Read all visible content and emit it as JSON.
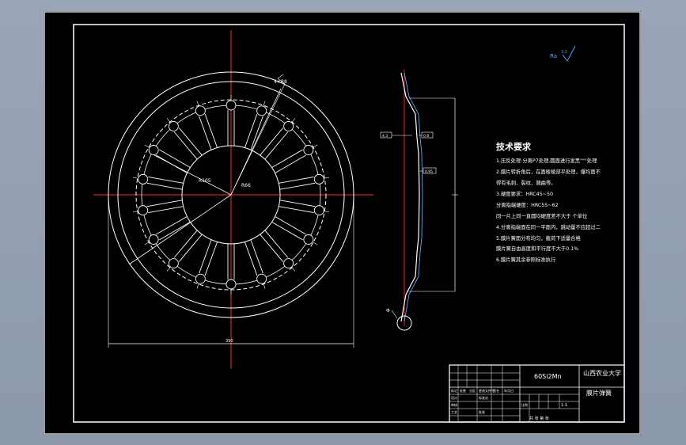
{
  "roughness": {
    "symbol": "Ra",
    "value": "3.2"
  },
  "tech_requirements": {
    "title": "技术要求",
    "lines": [
      "1.压反处理:分离P7处理,圆面进行发黑\"\"\"处理",
      "2.膜片转折角后，在面棱棱部平处理，爆均面不",
      "得有毛刺、裂纹、翘曲等。",
      "3.硬度要求：HRC45~50",
      "分离指端硬度：HRC55~62",
      "同一片上同一直圆均硬度差不大于 个单位",
      "4.分离指端面在同一平面内，跳动量不应超过二",
      "5.膜片簧面分布均匀，载荷下适量合格",
      "膜片簧自由高度和平行度不大于0.1%",
      "6.膜片簧其余参照标准执行"
    ]
  },
  "title_block": {
    "material": "60Si2Mn",
    "school": "山西农业大学",
    "part_name": "膜片弹簧",
    "scale_label": "比例",
    "scale": "1:1",
    "sheet_label": "共 张 第 张",
    "small_labels": [
      "标记",
      "处数",
      "分区",
      "更改文件号",
      "签名",
      "年月日",
      "设计",
      "标准化",
      "审核",
      "工艺",
      "批准"
    ]
  },
  "dimensions": {
    "outer_diameter": "Ø",
    "bottom_width": "390",
    "radius_label_1": "R105",
    "radius_label_2": "R66",
    "top_label": "4×R8",
    "section_labels": [
      "4.3",
      "0.8",
      "0.95"
    ],
    "bottom_symbol": "Φ"
  }
}
